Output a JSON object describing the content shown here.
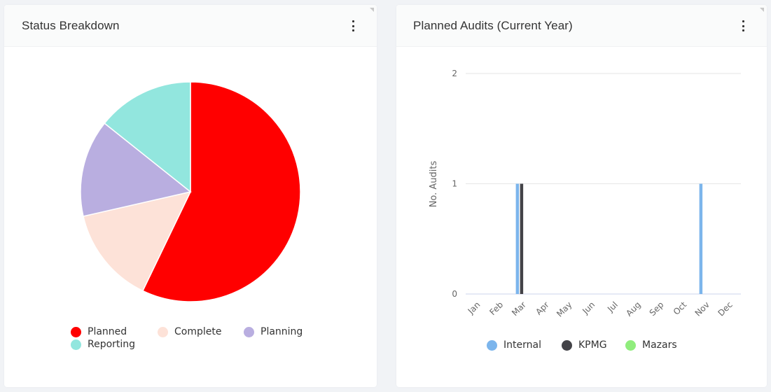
{
  "panels": {
    "status": {
      "title": "Status Breakdown",
      "menu_icon": "kebab-menu-icon"
    },
    "audits": {
      "title": "Planned Audits (Current Year)",
      "menu_icon": "kebab-menu-icon"
    }
  },
  "chart_data": [
    {
      "type": "pie",
      "title": "Status Breakdown",
      "categories": [
        "Planned",
        "Complete",
        "Planning",
        "Reporting"
      ],
      "values": [
        4,
        1,
        1,
        1
      ],
      "colors": [
        "#ff0000",
        "#fde2d8",
        "#b9aee0",
        "#92e6de"
      ],
      "legend": "bottom"
    },
    {
      "type": "bar",
      "title": "Planned Audits (Current Year)",
      "xlabel": "",
      "ylabel": "No. Audits",
      "ylim": [
        0,
        2
      ],
      "yticks": [
        0,
        1,
        2
      ],
      "grid": true,
      "categories": [
        "Jan",
        "Feb",
        "Mar",
        "Apr",
        "May",
        "Jun",
        "Jul",
        "Aug",
        "Sep",
        "Oct",
        "Nov",
        "Dec"
      ],
      "series": [
        {
          "name": "Internal",
          "color": "#7cb5ec",
          "values": [
            0,
            0,
            1,
            0,
            0,
            0,
            0,
            0,
            0,
            0,
            1,
            0
          ]
        },
        {
          "name": "KPMG",
          "color": "#434348",
          "values": [
            0,
            0,
            1,
            0,
            0,
            0,
            0,
            0,
            0,
            0,
            0,
            0
          ]
        },
        {
          "name": "Mazars",
          "color": "#90ed7d",
          "values": [
            0,
            0,
            0,
            0,
            0,
            0,
            0,
            0,
            0,
            0,
            0,
            0
          ]
        }
      ],
      "legend": "bottom"
    }
  ]
}
